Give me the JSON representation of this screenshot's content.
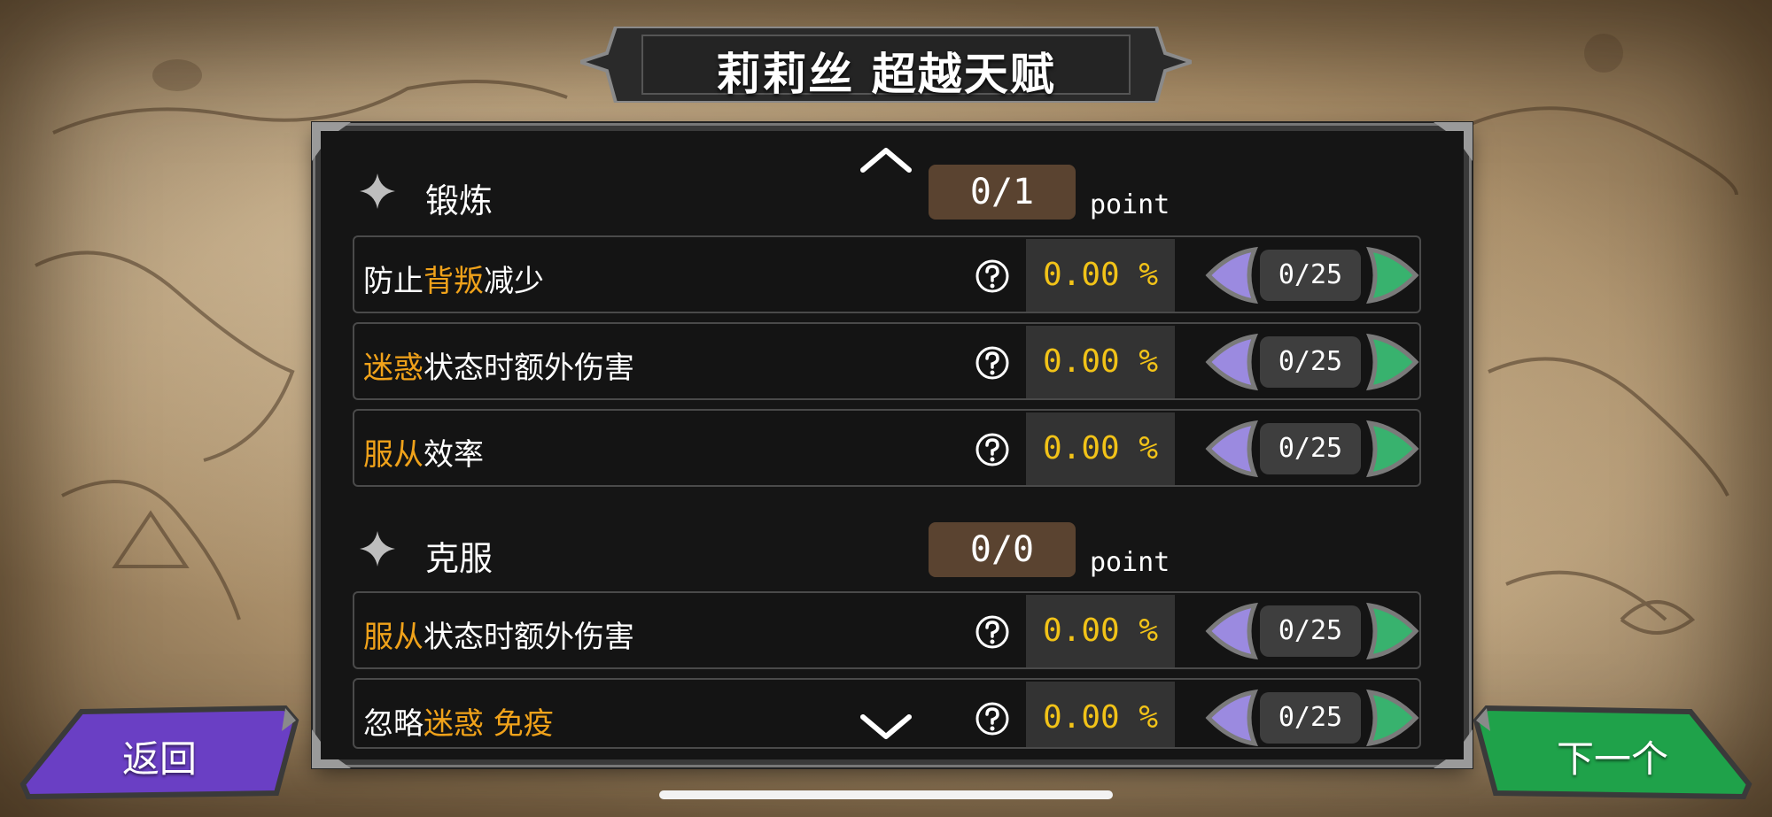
{
  "title": "莉莉丝  超越天赋",
  "sections": [
    {
      "name": "锻炼",
      "points": "0/1",
      "unit": "point"
    },
    {
      "name": "克服",
      "points": "0/0",
      "unit": "point"
    }
  ],
  "rows": [
    {
      "parts": [
        {
          "t": "防止",
          "hl": false
        },
        {
          "t": "背叛",
          "hl": true
        },
        {
          "t": "减少",
          "hl": false
        }
      ],
      "value": "0.00 %",
      "level": "0/25"
    },
    {
      "parts": [
        {
          "t": "迷惑",
          "hl": true
        },
        {
          "t": "状态时额外伤害",
          "hl": false
        }
      ],
      "value": "0.00 %",
      "level": "0/25"
    },
    {
      "parts": [
        {
          "t": "服从",
          "hl": true
        },
        {
          "t": "效率",
          "hl": false
        }
      ],
      "value": "0.00 %",
      "level": "0/25"
    },
    {
      "parts": [
        {
          "t": "服从",
          "hl": true
        },
        {
          "t": "状态时额外伤害",
          "hl": false
        }
      ],
      "value": "0.00 %",
      "level": "0/25"
    },
    {
      "parts": [
        {
          "t": "忽略",
          "hl": false
        },
        {
          "t": "迷惑  免疫",
          "hl": true
        }
      ],
      "value": "0.00 %",
      "level": "0/25"
    }
  ],
  "buttons": {
    "back": "返回",
    "next": "下一个"
  },
  "colors": {
    "highlight": "#f0a21a",
    "value": "#f2c318",
    "back": "#6a3fc4",
    "next": "#1fa24a"
  }
}
